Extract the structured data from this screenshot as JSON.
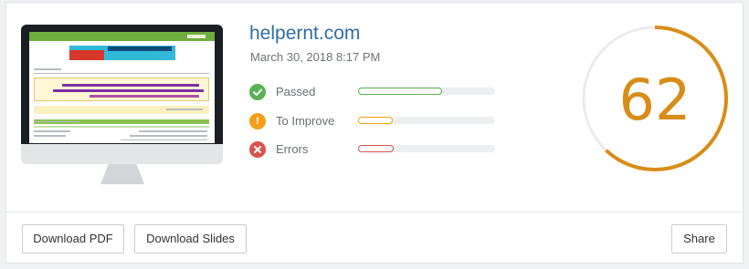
{
  "site": {
    "title": "helpernt.com",
    "date": "March 30, 2018 8:17 PM"
  },
  "metrics": [
    {
      "label": "Passed",
      "icon": "check-icon",
      "color": "#5ab055",
      "progress": 0.61
    },
    {
      "label": "To Improve",
      "icon": "exclamation-icon",
      "color": "#f29f19",
      "progress": 0.25
    },
    {
      "label": "Errors",
      "icon": "cross-icon",
      "color": "#d9534f",
      "progress": 0.26
    }
  ],
  "score": {
    "value": "62",
    "fraction": 0.62,
    "color": "#d88d19",
    "track_color": "#e9ebed"
  },
  "actions": {
    "download_pdf": "Download PDF",
    "download_slides": "Download Slides",
    "share": "Share"
  }
}
